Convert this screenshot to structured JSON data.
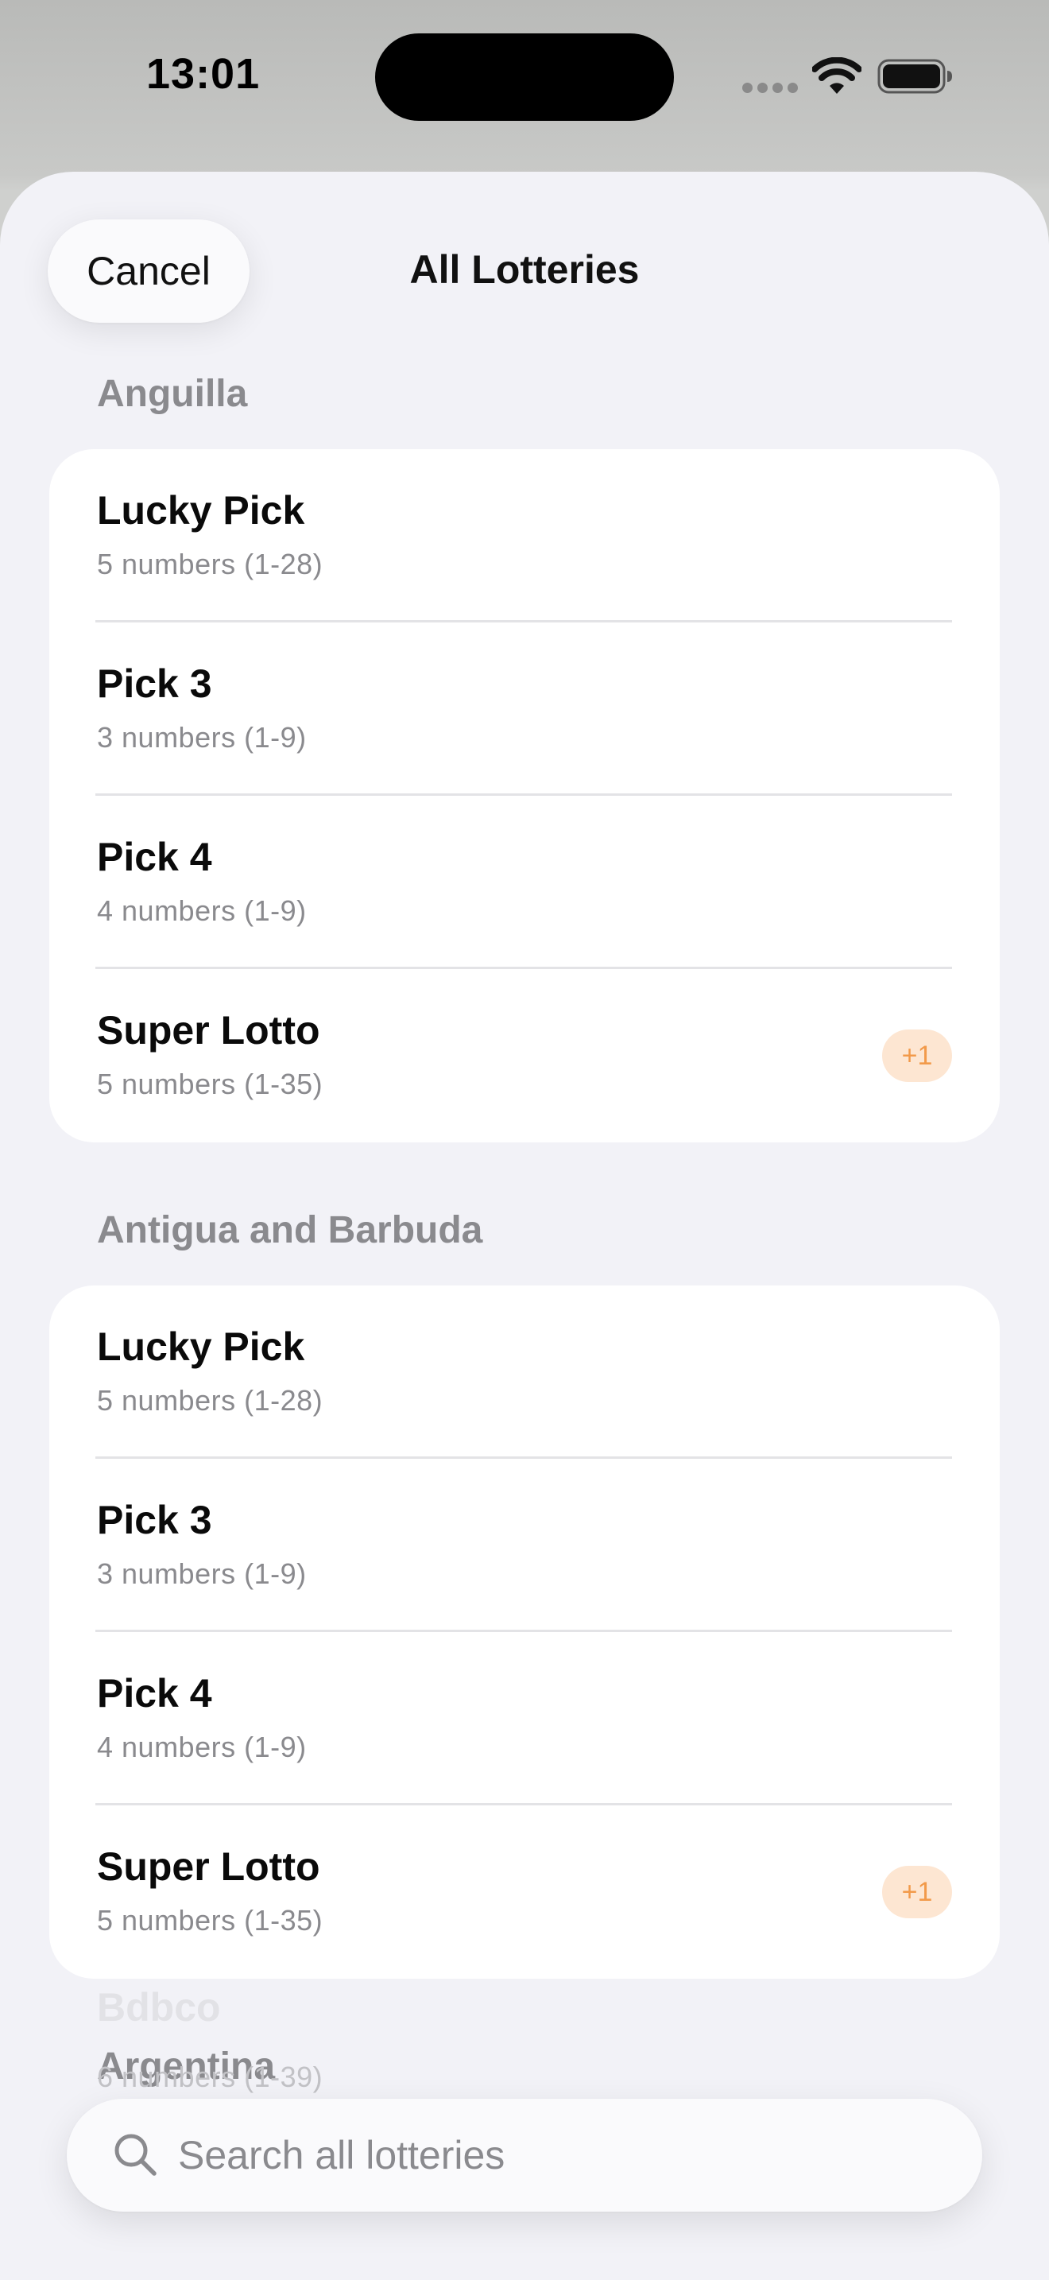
{
  "status_bar": {
    "time": "13:01"
  },
  "header": {
    "cancel_label": "Cancel",
    "title": "All Lotteries"
  },
  "sections": [
    {
      "name": "Anguilla",
      "items": [
        {
          "name": "Lucky Pick",
          "desc": "5 numbers (1-28)",
          "badge": ""
        },
        {
          "name": "Pick 3",
          "desc": "3 numbers (1-9)",
          "badge": ""
        },
        {
          "name": "Pick 4",
          "desc": "4 numbers (1-9)",
          "badge": ""
        },
        {
          "name": "Super Lotto",
          "desc": "5 numbers (1-35)",
          "badge": "+1"
        }
      ]
    },
    {
      "name": "Antigua and Barbuda",
      "items": [
        {
          "name": "Lucky Pick",
          "desc": "5 numbers (1-28)",
          "badge": ""
        },
        {
          "name": "Pick 3",
          "desc": "3 numbers (1-9)",
          "badge": ""
        },
        {
          "name": "Pick 4",
          "desc": "4 numbers (1-9)",
          "badge": ""
        },
        {
          "name": "Super Lotto",
          "desc": "5 numbers (1-35)",
          "badge": "+1"
        }
      ]
    },
    {
      "name": "Argentina",
      "items": [
        {
          "name": "Bdbco",
          "desc": "6 numbers (1-39)",
          "badge": ""
        }
      ]
    }
  ],
  "search": {
    "placeholder": "Search all lotteries",
    "value": ""
  },
  "colors": {
    "sheet_background": "#f2f2f7",
    "badge_background": "#fde6d2",
    "badge_text": "#f29a4a",
    "secondary_text": "#8a8a8e"
  },
  "icons": {
    "wifi": "wifi-icon",
    "battery": "battery-icon",
    "signal": "signal-dots-icon",
    "search": "search-icon"
  }
}
